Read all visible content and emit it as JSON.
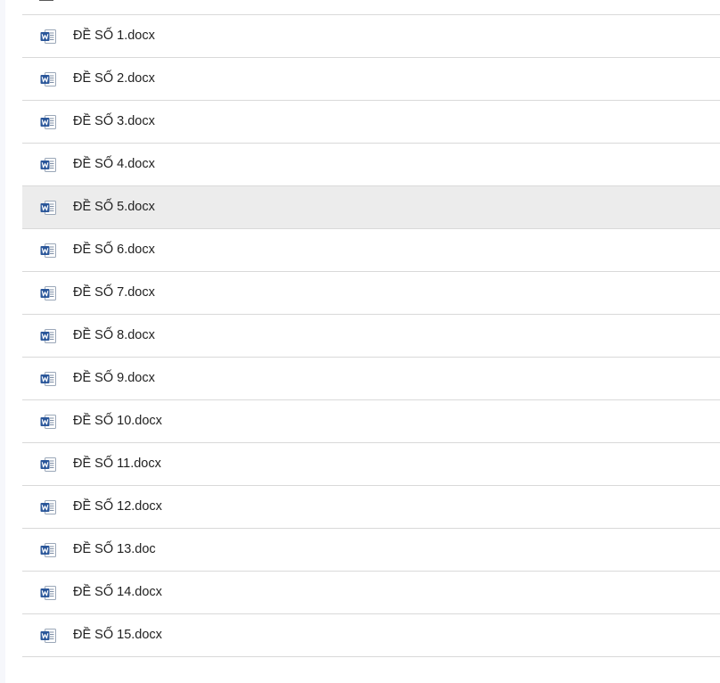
{
  "files": [
    {
      "name": "ĐỀ SỐ 1.docx",
      "icon": "word-doc-icon"
    },
    {
      "name": "ĐỀ SỐ 2.docx",
      "icon": "word-doc-icon"
    },
    {
      "name": "ĐỀ SỐ 3.docx",
      "icon": "word-doc-icon"
    },
    {
      "name": "ĐỀ SỐ 4.docx",
      "icon": "word-doc-icon"
    },
    {
      "name": "ĐỀ SỐ 5.docx",
      "icon": "word-doc-icon",
      "highlighted": true
    },
    {
      "name": "ĐỀ SỐ 6.docx",
      "icon": "word-doc-icon"
    },
    {
      "name": "ĐỀ SỐ 7.docx",
      "icon": "word-doc-icon"
    },
    {
      "name": "ĐỀ SỐ 8.docx",
      "icon": "word-doc-icon"
    },
    {
      "name": "ĐỀ SỐ 9.docx",
      "icon": "word-doc-icon"
    },
    {
      "name": "ĐỀ SỐ 10.docx",
      "icon": "word-doc-icon"
    },
    {
      "name": "ĐỀ SỐ 11.docx",
      "icon": "word-doc-icon"
    },
    {
      "name": "ĐỀ SỐ 12.docx",
      "icon": "word-doc-icon"
    },
    {
      "name": "ĐỀ SỐ 13.doc",
      "icon": "word-doc-icon"
    },
    {
      "name": "ĐỀ SỐ 14.docx",
      "icon": "word-doc-icon"
    },
    {
      "name": "ĐỀ SỐ 15.docx",
      "icon": "word-doc-icon"
    }
  ],
  "colors": {
    "word_blue": "#2b579a",
    "row_hover": "#ececec",
    "divider": "#d9d9d9"
  }
}
